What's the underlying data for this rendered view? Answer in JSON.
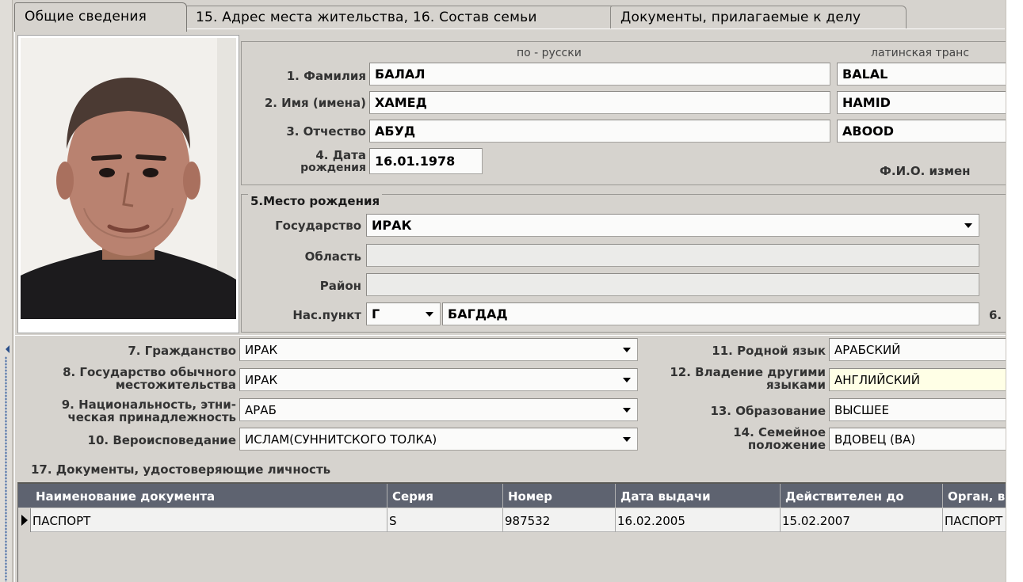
{
  "tabs": [
    {
      "label": "Общие сведения",
      "active": true
    },
    {
      "label": "15. Адрес места жительства, 16. Состав семьи",
      "active": false
    },
    {
      "label": "Документы, прилагаемые к делу",
      "active": false
    }
  ],
  "names": {
    "header_ru": "по - русски",
    "header_lat": "латинская транс",
    "surname_label": "1. Фамилия",
    "surname_ru": "БАЛАЛ",
    "surname_lat": "BALAL",
    "name_label": "2. Имя (имена)",
    "name_ru": "ХАМЕД",
    "name_lat": "HAMID",
    "patronymic_label": "3. Отчество",
    "patronymic_ru": "АБУД",
    "patronymic_lat": "ABOOD",
    "birthdate_label_1": "4. Дата",
    "birthdate_label_2": "рождения",
    "birthdate": "16.01.1978",
    "fio_changed_label": "Ф.И.О. измен"
  },
  "birthplace": {
    "legend": "5.Место рождения",
    "country_label": "Государство",
    "country": "ИРАК",
    "region_label": "Область",
    "region": "",
    "district_label": "Район",
    "district": "",
    "locality_label": "Нас.пункт",
    "locality_type": "Г",
    "locality": "БАГДАД",
    "side_label": "6."
  },
  "details": {
    "citizenship_label": "7. Гражданство",
    "citizenship": "ИРАК",
    "residence_label_1": "8. Государство обычного",
    "residence_label_2": "местожительства",
    "residence": "ИРАК",
    "nationality_label_1": "9. Национальность, этни-",
    "nationality_label_2": "ческая принадлежность",
    "nationality": "АРАБ",
    "religion_label": "10. Вероисповедание",
    "religion": "ИСЛАМ(СУННИТСКОГО ТОЛКА)",
    "language_label": "11. Родной язык",
    "language": "АРАБСКИЙ",
    "other_lang_label_1": "12. Владение другими",
    "other_lang_label_2": "языками",
    "other_lang": "АНГЛИЙСКИЙ",
    "education_label": "13. Образование",
    "education": "ВЫСШЕЕ",
    "marital_label_1": "14. Семейное",
    "marital_label_2": "положение",
    "marital": "ВДОВЕЦ (ВА)"
  },
  "documents": {
    "title": "17. Документы, удостоверяющие личность",
    "columns": [
      "Наименование документа",
      "Серия",
      "Номер",
      "Дата выдачи",
      "Действителен до",
      "Орган, вы"
    ],
    "rows": [
      [
        "ПАСПОРТ",
        "S",
        "987532",
        "16.02.2005",
        "15.02.2007",
        "ПАСПОРТ"
      ]
    ]
  },
  "colors": {
    "panel": "#d6d3ce",
    "grid_header": "#5e6370",
    "highlight_field": "#ffffe6"
  }
}
